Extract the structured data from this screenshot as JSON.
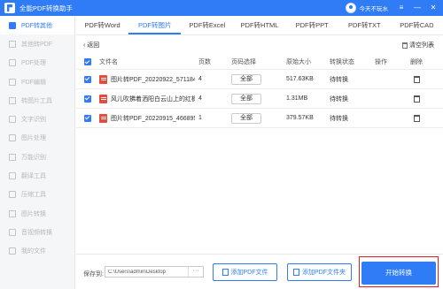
{
  "app": {
    "title": "全能PDF转换助手",
    "username": "今天不玩水",
    "window_controls": [
      "≡",
      "—",
      "✕"
    ]
  },
  "sidebar": {
    "items": [
      {
        "label": "PDF转其他",
        "active": true
      },
      {
        "label": "其他转PDF"
      },
      {
        "label": "PDF处理"
      },
      {
        "label": "PDF编辑"
      },
      {
        "label": "转图片工具"
      },
      {
        "label": "文字识别"
      },
      {
        "label": "图片处理"
      },
      {
        "label": "万能识别"
      },
      {
        "label": "翻译工具"
      },
      {
        "label": "压缩工具"
      },
      {
        "label": "图片转换"
      },
      {
        "label": "音视频转换"
      },
      {
        "label": "我的文件"
      }
    ]
  },
  "tabs": [
    {
      "label": "PDF转Word"
    },
    {
      "label": "PDF转图片",
      "active": true
    },
    {
      "label": "PDF转Excel"
    },
    {
      "label": "PDF转HTML"
    },
    {
      "label": "PDF转PPT"
    },
    {
      "label": "PDF转TXT"
    },
    {
      "label": "PDF转CAD"
    }
  ],
  "toolbar": {
    "back_label": "返回",
    "clear_label": "清空列表"
  },
  "table": {
    "headers": {
      "name": "文件名",
      "pages": "页数",
      "range": "页码选择",
      "size": "原始大小",
      "status": "转换状态",
      "action": "操作",
      "delete": "删除"
    },
    "rows": [
      {
        "name": "图片转PDF_20220922_571184...",
        "pages": "4",
        "range": "全部",
        "size": "517.63KB",
        "status": "待转换"
      },
      {
        "name": "风儿吹拂着洒阳白云山上的红枫...",
        "pages": "4",
        "range": "全部",
        "size": "1.31MB",
        "status": "待转换"
      },
      {
        "name": "图片转PDF_20220915_466895...",
        "pages": "1",
        "range": "全部",
        "size": "379.57KB",
        "status": "待转换"
      }
    ]
  },
  "bottom": {
    "save_label": "保存到:",
    "path_value": "C:\\Users\\admin\\Desktop",
    "browse_label": "···",
    "add_file_label": "添加PDF文件",
    "add_folder_label": "添加PDF文件夹",
    "start_label": "开始转换"
  },
  "colors": {
    "accent": "#2f7cf6",
    "highlight": "#e02020",
    "pdf_icon": "#e84a3b"
  }
}
